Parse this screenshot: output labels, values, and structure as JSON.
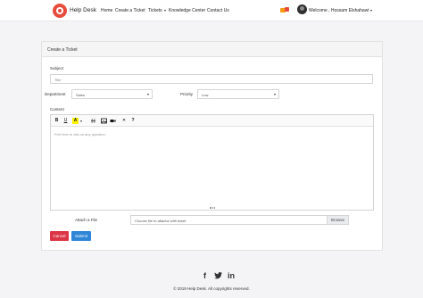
{
  "nav": {
    "brand": "Help Desk",
    "items": [
      {
        "label": "Home"
      },
      {
        "label": "Create a Ticket"
      },
      {
        "label": "Tickets"
      },
      {
        "label": "Knowledge Center"
      },
      {
        "label": "Contact Us"
      }
    ],
    "welcome": "Welcome , Hossam Elshahawi"
  },
  "form": {
    "card_title": "Create a Ticket",
    "subject_label": "Subject",
    "subject_placeholder": "Title",
    "department_label": "Department",
    "department_value": "Sales",
    "priority_label": "Priority",
    "priority_value": "Low",
    "content_label": "Content",
    "editor_placeholder": "Feel free to ask us any question.",
    "toolbar": {
      "bold": "B",
      "underline": "U",
      "color": "A",
      "remove_format": "✕",
      "help": "?"
    },
    "attach_label": "Attach a File",
    "attach_placeholder": "Choose file to attache with ticket",
    "browse_label": "Browse",
    "cancel_label": "Cancel",
    "submit_label": "Submit"
  },
  "footer": {
    "social": [
      "facebook-icon",
      "twitter-icon",
      "linkedin-icon"
    ],
    "copyright": "© 2019 Help Desk. All copyrights reserved."
  },
  "colors": {
    "cancel": "#dc3545",
    "submit": "#2f86d6",
    "highlight": "#fff200",
    "logo": "#e74c3c"
  }
}
